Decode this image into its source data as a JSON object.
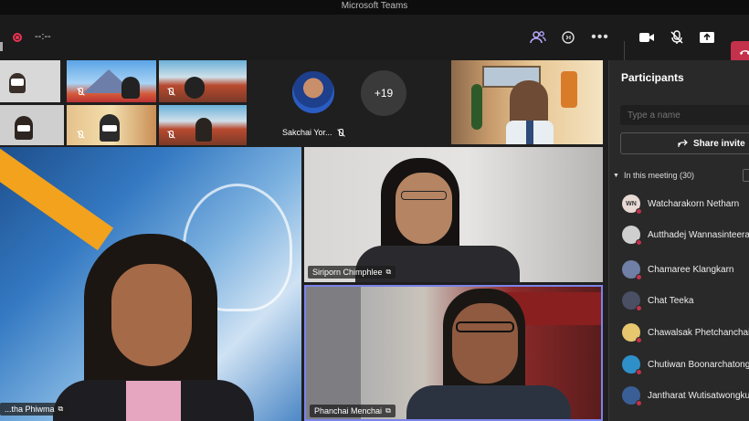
{
  "app": {
    "title": "Microsoft Teams"
  },
  "toolbar": {
    "timer": "--:--",
    "participants_icon": "people-icon",
    "raise_hand_icon": "raise-hand-icon",
    "more_icon": "more-icon",
    "camera_icon": "camera-icon",
    "mic_icon": "mic-off-icon",
    "share_icon": "share-screen-icon",
    "leave_color": "#c4314b"
  },
  "thumbnails": {
    "featured_name": "Sakchai Yor...",
    "overflow_count": "+19"
  },
  "videos": [
    {
      "name": "...tha Phiwma"
    },
    {
      "name": "Siriporn Chimphlee"
    },
    {
      "name": "Phanchai Menchai"
    }
  ],
  "panel": {
    "title": "Participants",
    "search_placeholder": "Type a name",
    "share_invite": "Share invite",
    "section_label": "In this meeting (30)",
    "participants": [
      {
        "name": "Watcharakorn Netharn",
        "initials": "WN",
        "color": "#e8d9d4"
      },
      {
        "name": "Autthadej Wannasinteerak",
        "initials": "",
        "color": "#cfcfcf"
      },
      {
        "name": "Chamaree Klangkarn",
        "initials": "",
        "color": "#6f7fa5"
      },
      {
        "name": "Chat Teeka",
        "initials": "",
        "color": "#4a4f64"
      },
      {
        "name": "Chawalsak Phetchanchai",
        "initials": "",
        "color": "#e6c66e"
      },
      {
        "name": "Chutiwan Boonarchatong",
        "initials": "",
        "color": "#2f8fc8"
      },
      {
        "name": "Jantharat Wutisatwongkul",
        "initials": "",
        "color": "#3a5f96"
      }
    ]
  }
}
